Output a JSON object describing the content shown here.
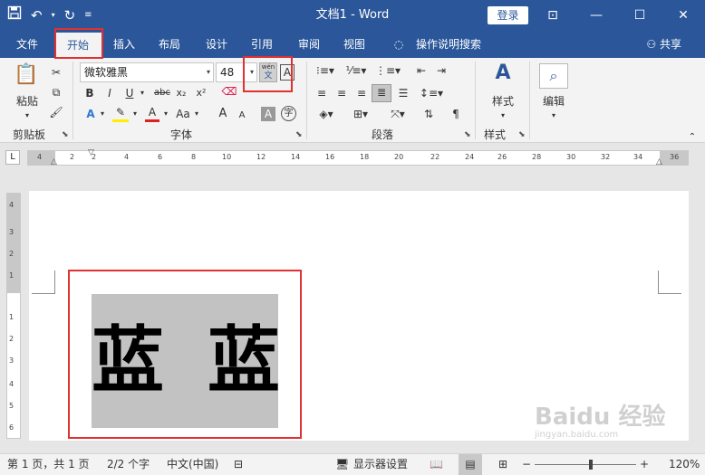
{
  "titlebar": {
    "doc_title": "文档1 - Word",
    "login_label": "登录",
    "qat": [
      "save-icon",
      "undo-icon",
      "redo-icon",
      "customize-icon"
    ],
    "window_buttons": [
      "ribbon-display-icon",
      "minimize-icon",
      "maximize-icon",
      "close-icon"
    ]
  },
  "tabs": {
    "items": [
      "文件",
      "开始",
      "插入",
      "布局",
      "设计",
      "引用",
      "审阅",
      "视图",
      "操作说明搜索"
    ],
    "active": "开始",
    "share_label": "共享"
  },
  "ribbon": {
    "clipboard": {
      "paste_label": "粘贴",
      "group_label": "剪贴板"
    },
    "font": {
      "font_name": "微软雅黑",
      "font_size": "48",
      "group_label": "字体",
      "row1_buttons": [
        "B",
        "I",
        "U",
        "abc",
        "x₂",
        "x²"
      ],
      "row2_buttons": [
        "A",
        "A",
        "Aa",
        "A",
        "A",
        "A",
        "字"
      ],
      "phonetic_top": "wén",
      "phonetic_bottom": "文",
      "border_char": "A"
    },
    "paragraph": {
      "group_label": "段落"
    },
    "styles": {
      "label": "样式",
      "group_label": "样式"
    },
    "editing": {
      "label": "编辑"
    }
  },
  "ruler": {
    "corner": "L",
    "ticks": [
      "4",
      "2",
      "2",
      "4",
      "6",
      "8",
      "10",
      "12",
      "14",
      "16",
      "18",
      "20",
      "22",
      "24",
      "26",
      "28",
      "30",
      "32",
      "34",
      "36"
    ],
    "vticks": [
      "4",
      "3",
      "2",
      "1",
      "1",
      "2",
      "3",
      "4",
      "5",
      "6"
    ]
  },
  "document": {
    "text": "蓝 蓝"
  },
  "statusbar": {
    "page": "第 1 页，共 1 页",
    "words": "2/2 个字",
    "language": "中文(中国)",
    "display_settings": "显示器设置",
    "zoom_minus": "−",
    "zoom_plus": "+",
    "zoom": "120%"
  },
  "watermark": {
    "brand": "Baidu 经验",
    "url": "jingyan.baidu.com"
  },
  "colors": {
    "accent": "#2b579a",
    "highlight_box": "#e03030",
    "text_highlight": "#c2c2c2"
  }
}
